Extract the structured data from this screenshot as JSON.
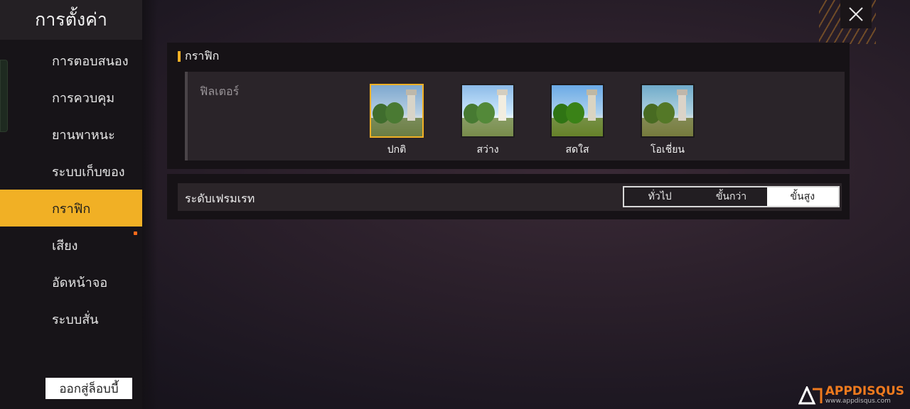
{
  "sidebar": {
    "title": "การตั้งค่า",
    "items": [
      {
        "label": "การตอบสนอง"
      },
      {
        "label": "การควบคุม"
      },
      {
        "label": "ยานพาหนะ"
      },
      {
        "label": "ระบบเก็บของ"
      },
      {
        "label": "กราฟิก"
      },
      {
        "label": "เสียง"
      },
      {
        "label": "อัดหน้าจอ"
      },
      {
        "label": "ระบบสั่น"
      }
    ],
    "active_index": 4,
    "exit_button": "ออกสู่ล็อบบี้"
  },
  "graphics": {
    "section_title": "กราฟิก",
    "filter": {
      "label": "ฟิลเตอร์",
      "options": [
        {
          "label": "ปกติ",
          "selected": true
        },
        {
          "label": "สว่าง",
          "selected": false
        },
        {
          "label": "สดใส",
          "selected": false
        },
        {
          "label": "โอเชี่ยน",
          "selected": false
        }
      ]
    },
    "frame_rate": {
      "label": "ระดับเฟรมเรท",
      "options": [
        "ทั่วไป",
        "ขั้นกว่า",
        "ขั้นสูง"
      ],
      "selected": "ขั้นสูง"
    }
  },
  "watermark": {
    "brand": "APPDISQUS",
    "site": "www.appdisqus.com"
  },
  "colors": {
    "accent": "#f1b025",
    "notification": "#ff6a1a"
  }
}
